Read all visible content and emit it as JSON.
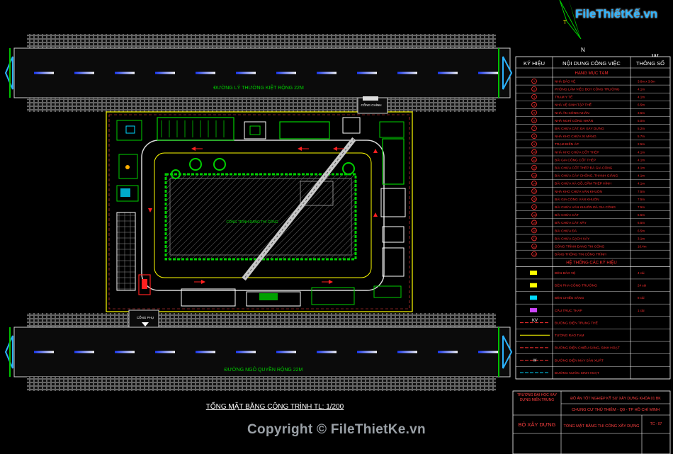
{
  "plan_title": "TỔNG MẶT BẰNG CÔNG TRÌNH TL: 1/200",
  "road_top_label": "ĐƯỜNG LÝ THƯỜNG KIỆT RỘNG 22M",
  "road_bottom_label": "ĐƯỜNG NGÔ QUYỀN RỘNG 22M",
  "building_label": "CÔNG TRÌNH ĐANG THI CÔNG",
  "gate_top_label": "CỔNG CHÍNH",
  "gate_bottom_label": "CỔNG PHỤ",
  "compass": {
    "north": "N",
    "east": "T",
    "west": "W"
  },
  "logo_text": "FileThiếtKế.vn",
  "copyright": "Copyright © FileThietKe.vn",
  "legend": {
    "headers": {
      "symbol": "KÝ HIỆU",
      "content": "NỘI DUNG CÔNG VIỆC",
      "spec": "THÔNG SỐ"
    },
    "section1": "HẠNG MỤC TẠM",
    "section2": "HỆ THỐNG CÁC KÝ HIỆU",
    "items": [
      {
        "n": "1",
        "label": "NHÀ BẢO VỆ",
        "spec": "3.6m x 3.0m"
      },
      {
        "n": "2",
        "label": "PHÒNG LÀM VIỆC BCH CÔNG TRƯỜNG",
        "spec": "4.1m"
      },
      {
        "n": "3",
        "label": "TRẠM Y TẾ",
        "spec": "4.1m"
      },
      {
        "n": "4",
        "label": "NHÀ VỆ SINH TẬP THỂ",
        "spec": "6.5m"
      },
      {
        "n": "5",
        "label": "NHÀ ĂN CÔNG NHÂN",
        "spec": "3.5m"
      },
      {
        "n": "6",
        "label": "NHÀ NGHỈ CÔNG NHÂN",
        "spec": "5.0m"
      },
      {
        "n": "7",
        "label": "BÃI CHỨA CÁT, ĐÁ XÂY DỰNG",
        "spec": "5.2m"
      },
      {
        "n": "8",
        "label": "NHÀ KHO CHỨA XI MĂNG",
        "spec": "5.7m"
      },
      {
        "n": "9",
        "label": "TRẠM BIẾN ÁP",
        "spec": "2.5m"
      },
      {
        "n": "10",
        "label": "NHÀ KHO CHỨA CỐT THÉP",
        "spec": "4.1m"
      },
      {
        "n": "11",
        "label": "BÃI GIA CÔNG CỐT THÉP",
        "spec": "4.1m"
      },
      {
        "n": "12",
        "label": "BÃI CHỨA CỐT THÉP ĐÃ GIA CÔNG",
        "spec": "4.1m"
      },
      {
        "n": "13",
        "label": "BÃI CHỨA CÂY CHỐNG, THANH GIẰNG",
        "spec": "4.1m"
      },
      {
        "n": "14",
        "label": "BÃI CHỨA XÀ GỒ, DẦM THÉP HÌNH",
        "spec": "4.1m"
      },
      {
        "n": "15",
        "label": "NHÀ KHO CHỨA VÁN KHUÔN",
        "spec": "7.5m"
      },
      {
        "n": "16",
        "label": "BÃI GIA CÔNG VÁN KHUÔN",
        "spec": "7.5m"
      },
      {
        "n": "17",
        "label": "BÃI CHỨA VÁN KHUÔN ĐÃ GIA CÔNG",
        "spec": "7.5m"
      },
      {
        "n": "18",
        "label": "BÃI CHỨA CÁT",
        "spec": "6.5m"
      },
      {
        "n": "19",
        "label": "BÃI CHỨA CÁT XÂY",
        "spec": "6.5m"
      },
      {
        "n": "20",
        "label": "BÃI CHỨA ĐÁ",
        "spec": "6.5m"
      },
      {
        "n": "21",
        "label": "BÃI CHỨA GẠCH XÂY",
        "spec": "3.1m"
      },
      {
        "n": "22",
        "label": "CÔNG TRÌNH ĐANG THI CÔNG",
        "spec": "16.4m"
      },
      {
        "n": "23",
        "label": "BẢNG THÔNG TIN CÔNG TRÌNH",
        "spec": ""
      }
    ],
    "symbols": [
      {
        "label": "ĐÈN BẢO VỆ",
        "spec": "4 cái"
      },
      {
        "label": "ĐÈN PHA CÔNG TRƯỜNG",
        "spec": "24 cái"
      },
      {
        "label": "ĐÈN CHIẾU SÁNG",
        "spec": "8 cái"
      },
      {
        "label": "CẦU TRỤC THÁP",
        "spec": "1 cái"
      },
      {
        "label": "ĐƯỜNG ĐIỆN TRUNG THẾ",
        "spec": ""
      },
      {
        "label": "TƯỜNG RÀO TẠM",
        "spec": ""
      },
      {
        "label": "ĐƯỜNG ĐIỆN CHIẾU SÁNG, SINH HOẠT",
        "spec": ""
      },
      {
        "label": "ĐƯỜNG ĐIỆN MÁY SẢN XUẤT",
        "spec": ""
      },
      {
        "label": "ĐƯỜNG NƯỚC SINH HOẠT",
        "spec": ""
      }
    ],
    "kv_text": "KV",
    "w_text": "W"
  },
  "title_block": {
    "school": "TRƯỜNG ĐẠI HỌC XÂY DỰNG MIỀN TRUNG",
    "project": "ĐỒ ÁN TỐT NGHIỆP KỸ SƯ XÂY DỰNG KHÓA 01 BK",
    "building": "CHUNG CƯ THỦ THIÊM - Q9 - TP HỒ CHÍ MINH",
    "ministry": "BỘ XÂY DỰNG",
    "drawing": "TỔNG MẶT BẰNG THI CÔNG XÂY DỰNG",
    "sheet": "TC - 07"
  },
  "colors": {
    "background": "#000000",
    "road": "#1a1a1a",
    "road_edge": "#bbbbbb",
    "fence": "#ffff00",
    "site_road": "#d8d8d8",
    "green": "#00d000",
    "red": "#ff2020",
    "cyan": "#00d8ff",
    "blue_marker": "#2060ff"
  }
}
